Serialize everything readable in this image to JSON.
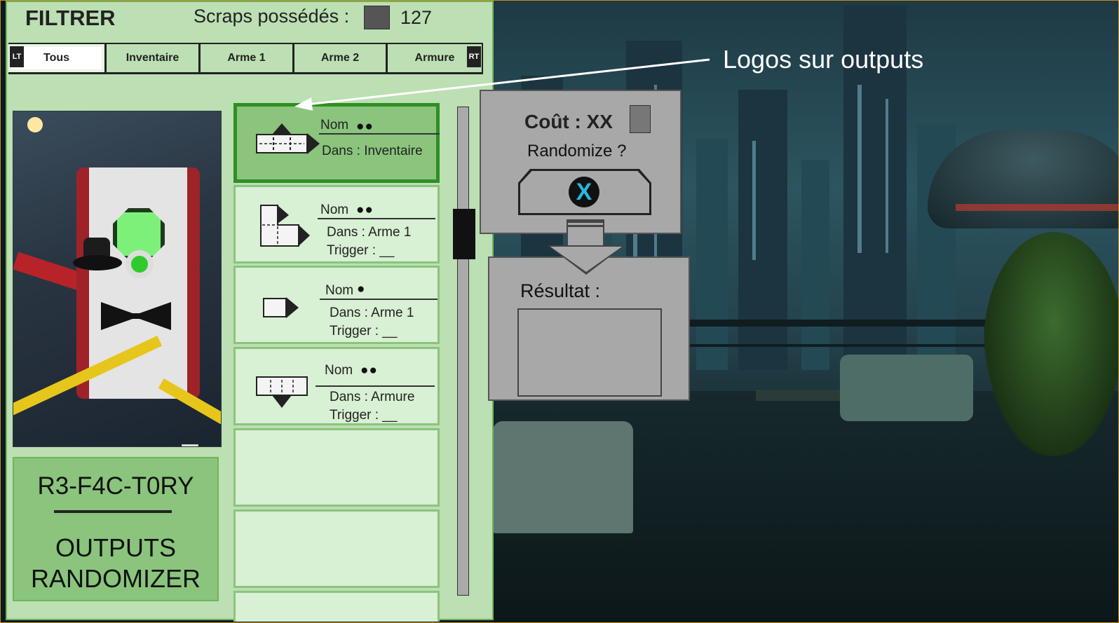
{
  "header": {
    "filter_title": "FILTRER",
    "scraps_label": "Scraps possédés :",
    "scraps_count": "127"
  },
  "tabs": {
    "left_button": "LT",
    "right_button": "RT",
    "items": [
      {
        "label": "Tous",
        "active": true
      },
      {
        "label": "Inventaire",
        "active": false
      },
      {
        "label": "Arme 1",
        "active": false
      },
      {
        "label": "Arme 2",
        "active": false
      },
      {
        "label": "Armure",
        "active": false
      }
    ]
  },
  "machine": {
    "name": "R3-F4C-T0RY",
    "subtitle_line1": "OUTPUTS",
    "subtitle_line2": "RANDOMIZER"
  },
  "outputs": [
    {
      "name": "Nom",
      "dots": "●●",
      "location": "Dans : Inventaire",
      "trigger": "",
      "icon": "arrow-up-right-shape-icon",
      "selected": true
    },
    {
      "name": "Nom",
      "dots": "●●",
      "location": "Dans : Arme 1",
      "trigger": "Trigger : __",
      "icon": "l-shape-arrow-icon",
      "selected": false
    },
    {
      "name": "Nom",
      "dots": "●",
      "location": "Dans : Arme 1",
      "trigger": "Trigger : __",
      "icon": "small-arrow-right-icon",
      "selected": false
    },
    {
      "name": "Nom",
      "dots": "●●",
      "location": "Dans : Armure",
      "trigger": "Trigger : __",
      "icon": "arrow-down-shape-icon",
      "selected": false
    }
  ],
  "randomize": {
    "cost_label": "Coût : XX",
    "question": "Randomize ?",
    "button_glyph": "X",
    "result_label": "Résultat :"
  },
  "annotation": {
    "text": "Logos sur outputs"
  },
  "colors": {
    "panel_bg": "#bcdfb3",
    "panel_accent": "#8ac47d",
    "selected_border": "#2f8f23",
    "dialog_bg": "#a8a8a8",
    "x_button": "#29b6e0"
  }
}
